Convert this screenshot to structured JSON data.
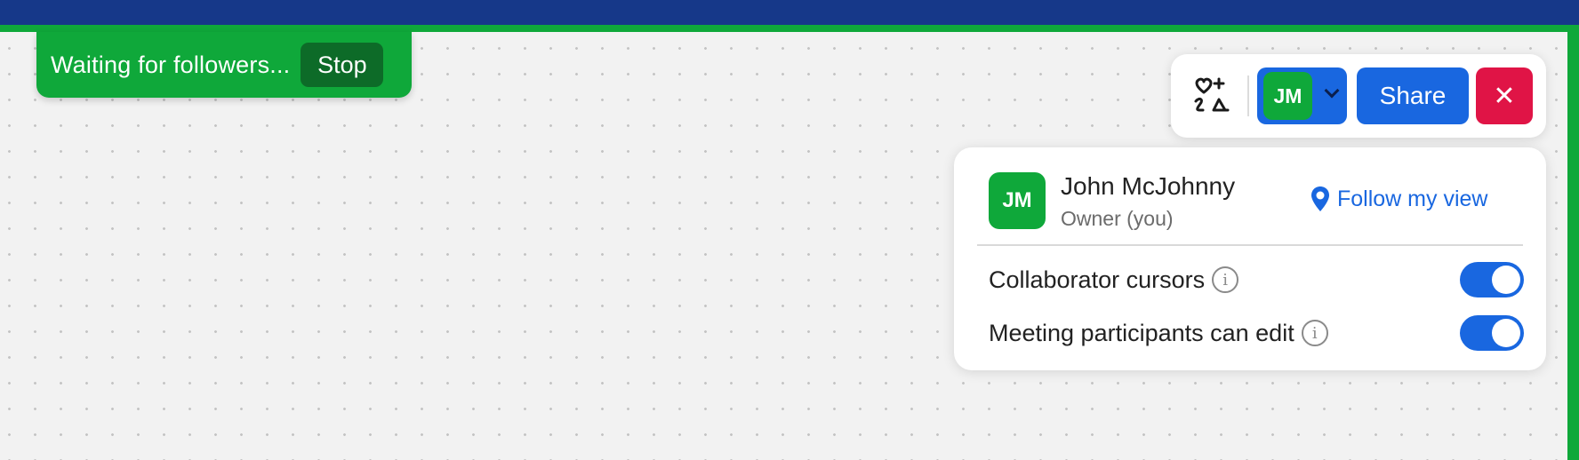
{
  "follow_banner": {
    "text": "Waiting for followers...",
    "stop_label": "Stop"
  },
  "toolbar": {
    "reactions_icon": "reactions-icon",
    "avatar_initials": "JM",
    "share_label": "Share",
    "close_label": "✕"
  },
  "panel": {
    "user": {
      "initials": "JM",
      "name": "John McJohnny",
      "role": "Owner (you)"
    },
    "follow_link": "Follow my view",
    "settings": [
      {
        "label": "Collaborator cursors",
        "enabled": true
      },
      {
        "label": "Meeting participants can edit",
        "enabled": true
      }
    ]
  },
  "colors": {
    "accent_blue": "#1967e0",
    "follow_green": "#0fa83a",
    "close_red": "#e01446",
    "topbar": "#163889"
  }
}
